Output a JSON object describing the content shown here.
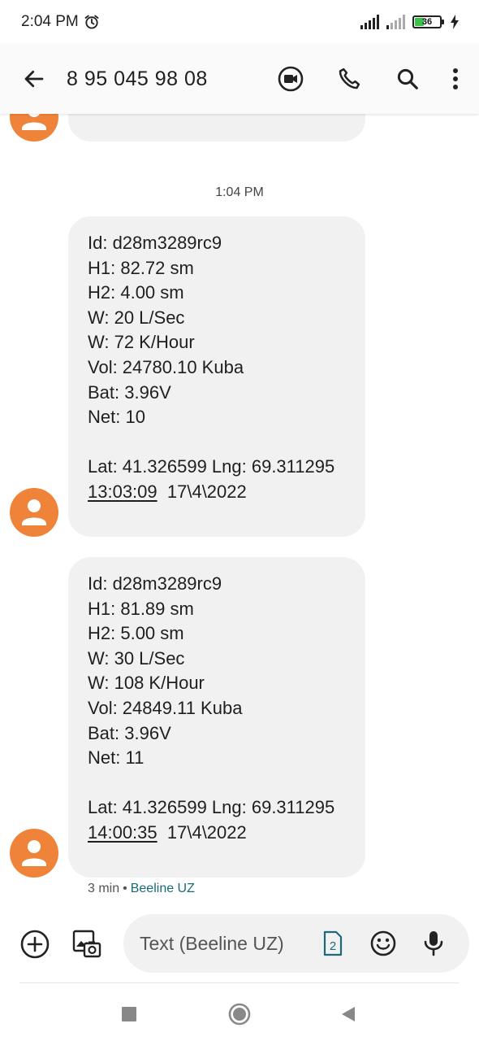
{
  "status_bar": {
    "time": "2:04 PM",
    "battery_level": "36",
    "battery_color": "#3cc24a"
  },
  "header": {
    "contact": "8 95 045 98 08",
    "icons": [
      "back-arrow-icon",
      "video-call-icon",
      "phone-icon",
      "search-icon",
      "more-vert-icon"
    ]
  },
  "conversation": {
    "time_divider": "1:04 PM",
    "messages": [
      {
        "lines": [
          "Id: d28m3289rc9",
          "H1: 82.72 sm",
          "H2: 4.00 sm",
          "W: 20 L/Sec",
          "W: 72 K/Hour",
          "Vol: 24780.10 Kuba",
          "Bat: 3.96V",
          "Net: 10",
          "",
          "Lat: 41.326599 Lng: 69.311295"
        ],
        "time_link": "13:03:09",
        "date": "17\\4\\2022"
      },
      {
        "lines": [
          "Id: d28m3289rc9",
          "H1: 81.89 sm",
          "H2: 5.00 sm",
          "W: 30 L/Sec",
          "W: 108 K/Hour",
          "Vol: 24849.11 Kuba",
          "Bat: 3.96V",
          "Net: 11",
          "",
          "Lat: 41.326599 Lng: 69.311295"
        ],
        "time_link": "14:00:35",
        "date": "17\\4\\2022"
      }
    ],
    "meta": {
      "age": "3 min",
      "separator": "•",
      "carrier": "Beeline UZ"
    }
  },
  "compose": {
    "placeholder": "Text (Beeline UZ)",
    "sim_number": "2",
    "accent_color": "#1a6b7a"
  },
  "colors": {
    "avatar": "#f0833a",
    "bubble": "#f1f1f1"
  }
}
